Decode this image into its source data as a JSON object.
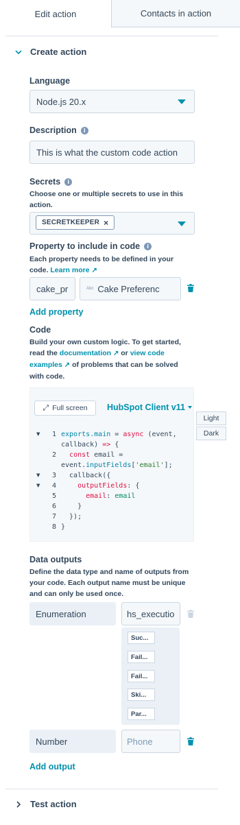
{
  "tabs": {
    "edit": "Edit action",
    "contacts": "Contacts in action"
  },
  "create_section": {
    "title": "Create action"
  },
  "language": {
    "label": "Language",
    "value": "Node.js 20.x"
  },
  "description": {
    "label": "Description",
    "value": "This is what the custom code action"
  },
  "secrets": {
    "label": "Secrets",
    "help": "Choose one or multiple secrets to use in this action.",
    "tag": "SECRETKEEPER",
    "tag_remove": "×"
  },
  "property": {
    "label": "Property to include in code",
    "help": "Each property needs to be defined in your code.",
    "learn_more": "Learn more",
    "name_value": "cake_pr",
    "abc": "Abc",
    "prop_value": "Cake Preferenc",
    "add": "Add property"
  },
  "code": {
    "label": "Code",
    "help_1": "Build your own custom logic. To get started, read the",
    "documentation": "documentation",
    "or": "or",
    "view_examples": "view code examples",
    "help_2": "of problems that can be solved with code.",
    "fullscreen": "Full screen",
    "client": "HubSpot Client v11",
    "light": "Light",
    "dark": "Dark",
    "lines": [
      {
        "n": "1",
        "fold": "▼",
        "t": "exports.main = async (event,"
      },
      {
        "n": "",
        "fold": "",
        "t": "callback) => {"
      },
      {
        "n": "2",
        "fold": "",
        "t": "  const email ="
      },
      {
        "n": "",
        "fold": "",
        "t": "event.inputFields['email'];"
      },
      {
        "n": "3",
        "fold": "▼",
        "t": "  callback({"
      },
      {
        "n": "4",
        "fold": "▼",
        "t": "    outputFields: {"
      },
      {
        "n": "5",
        "fold": "",
        "t": "      email: email"
      },
      {
        "n": "6",
        "fold": "",
        "t": "    }"
      },
      {
        "n": "7",
        "fold": "",
        "t": "  });"
      },
      {
        "n": "8",
        "fold": "",
        "t": "}"
      }
    ]
  },
  "outputs": {
    "label": "Data outputs",
    "help": "Define the data type and name of outputs from your code. Each output name must be unique and can only be used once.",
    "row1": {
      "type": "Enumeration",
      "name": "hs_executio"
    },
    "options": [
      "Suc...",
      "Fail...",
      "Fail...",
      "Ski...",
      "Par..."
    ],
    "row2": {
      "type": "Number",
      "name": "Phone"
    },
    "add": "Add output"
  },
  "test_section": {
    "title": "Test action"
  },
  "colors": {
    "accent": "#0091ae",
    "text": "#33475b",
    "border": "#cbd6e2",
    "field_bg": "#f5f8fa"
  }
}
